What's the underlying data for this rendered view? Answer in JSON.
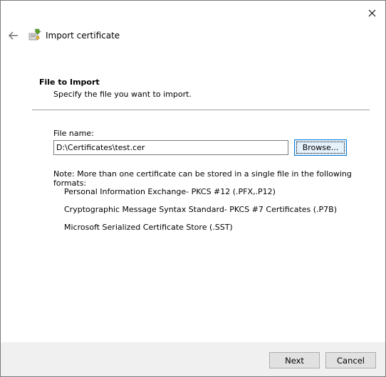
{
  "window": {
    "close_glyph": "✕"
  },
  "header": {
    "back_glyph": "←",
    "icon": "certificate-icon",
    "title": "Import certificate"
  },
  "page": {
    "heading": "File to Import",
    "subheading": "Specify the file you want to import."
  },
  "form": {
    "file_label": "File name:",
    "file_value": "D:\\Certificates\\test.cer",
    "browse_label": "Browse..."
  },
  "note": {
    "text": "Note:  More than one certificate can be stored in a single file in the following formats:",
    "formats": [
      "Personal Information Exchange- PKCS #12 (.PFX,.P12)",
      "Cryptographic Message Syntax Standard- PKCS #7 Certificates (.P7B)",
      "Microsoft Serialized Certificate Store (.SST)"
    ]
  },
  "footer": {
    "next_label": "Next",
    "cancel_label": "Cancel"
  },
  "colors": {
    "accent": "#0078d7",
    "footer_bg": "#f0f0f0"
  }
}
